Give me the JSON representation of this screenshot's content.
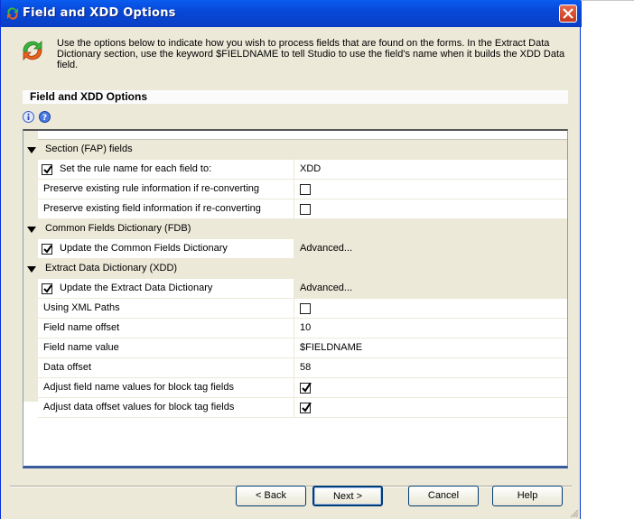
{
  "window": {
    "title": "Field and XDD Options",
    "accent": "#0a5cf0"
  },
  "intro": {
    "text": "Use the options below to indicate how you wish to process fields that are found on the forms.  In the Extract Data Dictionary section, use the keyword $FIELDNAME to tell Studio to use the field's name when it builds the XDD Data field."
  },
  "panel": {
    "title": "Field and XDD Options",
    "icons": [
      "info-icon",
      "help-icon"
    ]
  },
  "grid": {
    "sections": [
      {
        "label": "Section (FAP) fields",
        "expanded": true,
        "rows": [
          {
            "name": "Set the rule name for each field to:",
            "checked": true,
            "value": "XDD",
            "kind": "text"
          },
          {
            "name": "Preserve existing rule information if re-converting",
            "checked": null,
            "value": false,
            "kind": "checkbox"
          },
          {
            "name": "Preserve existing field information if re-converting",
            "checked": null,
            "value": false,
            "kind": "checkbox"
          }
        ]
      },
      {
        "label": "Common Fields Dictionary (FDB)",
        "expanded": true,
        "rows": [
          {
            "name": "Update the Common Fields Dictionary",
            "checked": true,
            "value": "Advanced...",
            "kind": "button"
          }
        ]
      },
      {
        "label": "Extract Data Dictionary (XDD)",
        "expanded": true,
        "rows": [
          {
            "name": "Update the Extract Data Dictionary",
            "checked": true,
            "value": "Advanced...",
            "kind": "button"
          },
          {
            "name": "Using XML Paths",
            "checked": null,
            "value": false,
            "kind": "checkbox"
          },
          {
            "name": "Field name offset",
            "checked": null,
            "value": "10",
            "kind": "text"
          },
          {
            "name": "Field name value",
            "checked": null,
            "value": "$FIELDNAME",
            "kind": "text"
          },
          {
            "name": "Data offset",
            "checked": null,
            "value": "58",
            "kind": "text"
          },
          {
            "name": "Adjust field name values for block tag fields",
            "checked": null,
            "value": true,
            "kind": "checkbox"
          },
          {
            "name": "Adjust data offset values for block tag fields",
            "checked": null,
            "value": true,
            "kind": "checkbox"
          }
        ]
      }
    ]
  },
  "buttons": {
    "back": "< Back",
    "next": "Next >",
    "cancel": "Cancel",
    "help": "Help"
  }
}
